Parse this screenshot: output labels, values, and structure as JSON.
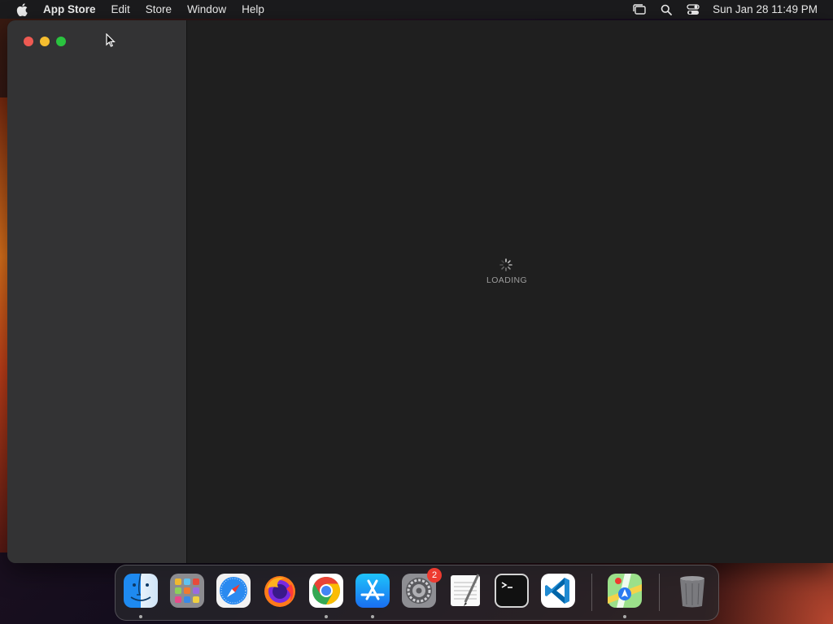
{
  "menubar": {
    "app_name": "App Store",
    "items": [
      "Edit",
      "Store",
      "Window",
      "Help"
    ],
    "clock": "Sun Jan 28  11:49 PM"
  },
  "content": {
    "loading_label": "LOADING"
  },
  "dock": {
    "badge_settings": "2",
    "apps": [
      "finder",
      "launchpad",
      "safari",
      "firefox",
      "chrome",
      "app-store",
      "system-settings",
      "textedit",
      "terminal",
      "vscode",
      "maps",
      "trash"
    ]
  },
  "colors": {
    "menubar": "#1b1b1d",
    "sidebar": "#333334",
    "content": "#1f1f1f",
    "close": "#ee5a52",
    "minimize": "#f5bd2f",
    "maximize": "#2ac33f",
    "badge": "#ee3b30"
  }
}
